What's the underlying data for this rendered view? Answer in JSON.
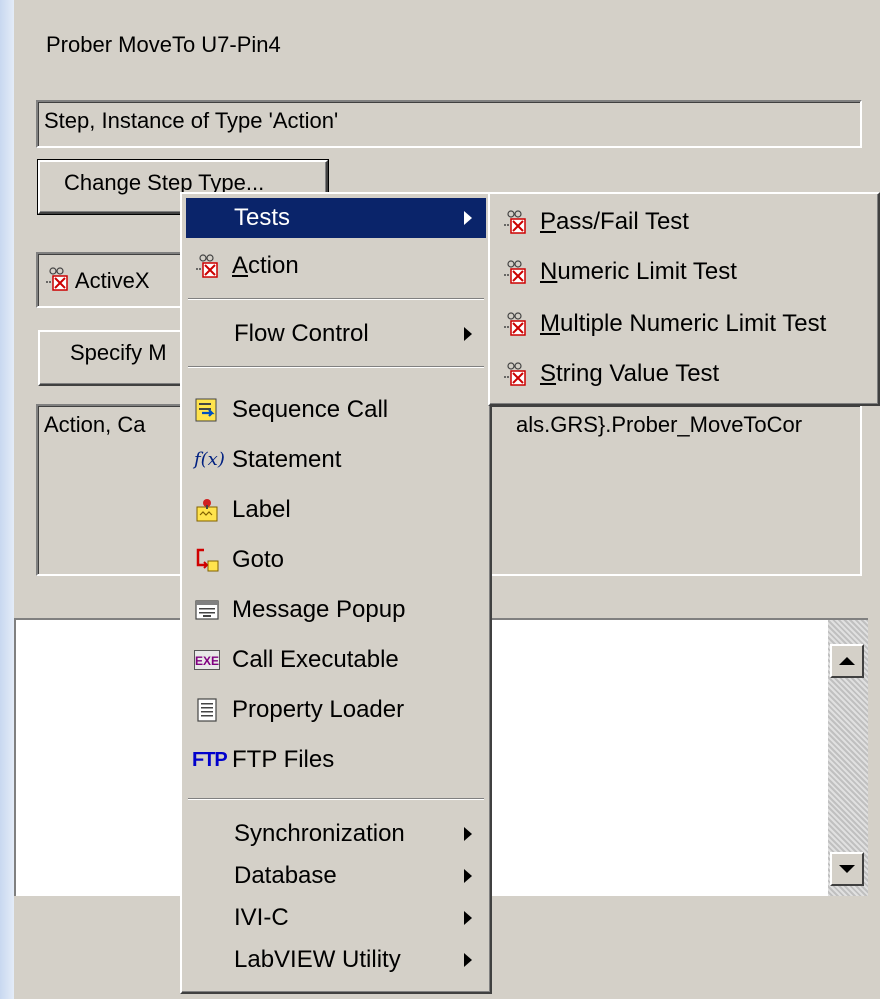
{
  "dialog": {
    "step_name": "Prober MoveTo U7-Pin4",
    "step_type_desc": "Step, Instance of Type 'Action'",
    "change_step_type_label": "Change Step Type...",
    "adapter_label": "ActiveX",
    "specify_label": "Specify M",
    "description_text": "Action,  Ca",
    "description_text_right": "als.GRS}.Prober_MoveToCor"
  },
  "menu": {
    "items": [
      {
        "label": "Tests",
        "icon": "",
        "submenu": true,
        "highlighted": true
      },
      {
        "label": "Action",
        "mnemonic": "A",
        "icon": "action-step-icon"
      },
      {
        "label": "Flow Control",
        "icon": "",
        "submenu": true
      },
      {
        "label": "Sequence Call",
        "icon": "sequence-call-icon"
      },
      {
        "label": "Statement",
        "icon": "statement-fx-icon"
      },
      {
        "label": "Label",
        "icon": "label-icon"
      },
      {
        "label": "Goto",
        "icon": "goto-icon"
      },
      {
        "label": "Message Popup",
        "icon": "message-popup-icon"
      },
      {
        "label": "Call Executable",
        "icon": "exe-icon"
      },
      {
        "label": "Property Loader",
        "icon": "property-loader-icon"
      },
      {
        "label": "FTP Files",
        "icon": "ftp-icon"
      },
      {
        "label": "Synchronization",
        "submenu": true
      },
      {
        "label": "Database",
        "submenu": true
      },
      {
        "label": "IVI-C",
        "submenu": true
      },
      {
        "label": "LabVIEW Utility",
        "submenu": true
      }
    ]
  },
  "submenu": {
    "items": [
      {
        "label": "Pass/Fail Test",
        "mnemonic": "P",
        "rest": "ass/Fail Test",
        "icon": "test-step-icon"
      },
      {
        "label": "Numeric Limit Test",
        "mnemonic": "N",
        "rest": "umeric Limit Test",
        "icon": "test-step-icon"
      },
      {
        "label": "Multiple Numeric Limit Test",
        "mnemonic": "M",
        "rest": "ultiple Numeric Limit Test",
        "icon": "test-step-icon"
      },
      {
        "label": "String Value Test",
        "mnemonic": "S",
        "rest": "tring Value Test",
        "icon": "test-step-icon"
      }
    ]
  },
  "icon_text": {
    "fx": "f(x)",
    "exe": "EXE",
    "ftp": "FTP"
  },
  "colors": {
    "window_bg": "#d4d0c8",
    "highlight": "#0a246a",
    "ftp_blue": "#0000cc"
  }
}
